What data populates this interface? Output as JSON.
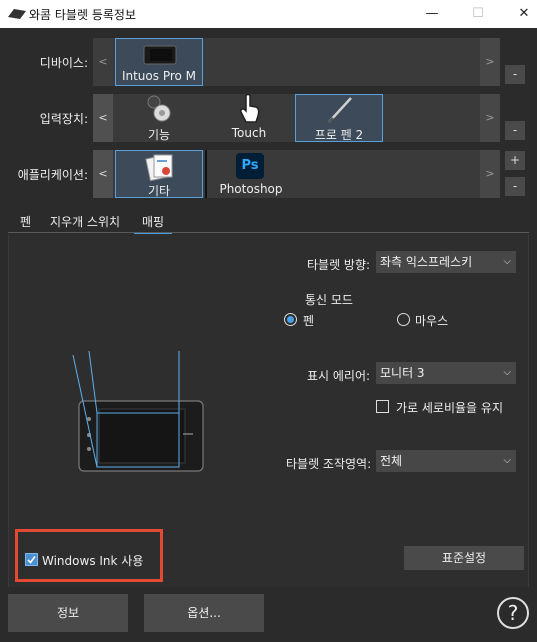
{
  "window": {
    "title": "와콤 타블렛 등록정보",
    "minimize": "—",
    "maximize": "☐",
    "close": "✕"
  },
  "rows": {
    "device": {
      "label": "디바이스:",
      "tiles": [
        "Intuos Pro M"
      ],
      "left_arrow": "<",
      "right_arrow": ">",
      "minus": "-"
    },
    "input": {
      "label": "입력장치:",
      "tiles": [
        "기능",
        "Touch",
        "프로 펜 2"
      ],
      "left_arrow": "<",
      "right_arrow": ">",
      "minus": "-"
    },
    "app": {
      "label": "애플리케이션:",
      "tiles": [
        "기타",
        "Photoshop"
      ],
      "left_arrow": "<",
      "right_arrow": ">",
      "plus": "+",
      "minus": "-"
    }
  },
  "tabs": [
    "펜",
    "지우개 스위치",
    "매핑"
  ],
  "mapping": {
    "orientation_label": "타블렛 방향:",
    "orientation_value": "좌측 익스프레스키",
    "mode_label": "통신 모드",
    "mode_pen": "펜",
    "mode_mouse": "마우스",
    "display_label": "표시 에리어:",
    "display_value": "모니터 3",
    "aspect_label": "가로 세로비율을 유지",
    "tablet_area_label": "타블렛 조작영역:",
    "tablet_area_value": "전체",
    "windows_ink_label": "Windows Ink 사용",
    "defaults_button": "표준설정"
  },
  "footer": {
    "about_button": "정보",
    "options_button": "옵션...",
    "help": "?"
  },
  "colors": {
    "accent": "#4a9fe0",
    "highlight": "#e24a33",
    "background": "#2b2b2b"
  }
}
